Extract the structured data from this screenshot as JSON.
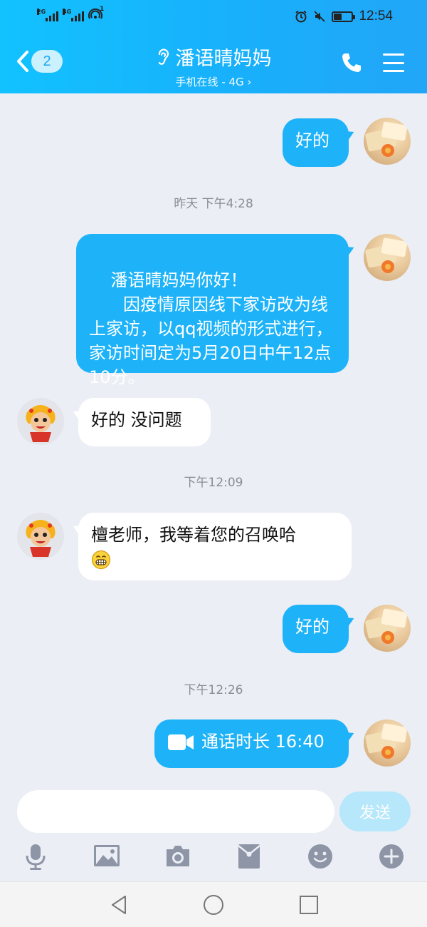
{
  "status_bar": {
    "signal1_tag": "2G",
    "signal2_tag": "4G",
    "hotspot_count": "1",
    "time": "12:54",
    "battery_level": 0.4
  },
  "title_bar": {
    "unread_count": "2",
    "contact_name": "潘语晴妈妈",
    "status": "手机在线 - 4G ›"
  },
  "messages": [
    {
      "type": "out",
      "text": "好的"
    },
    {
      "type": "time",
      "text": "昨天 下午4:28"
    },
    {
      "type": "out",
      "text": "潘语晴妈妈你好！\n　　因疫情原因线下家访改为线上家访，以qq视频的形式进行，家访时间定为5月20日中午12点10分。"
    },
    {
      "type": "in",
      "text": "好的 没问题"
    },
    {
      "type": "time",
      "text": "下午12:09"
    },
    {
      "type": "in",
      "text": "檀老师，我等着您的召唤哈"
    },
    {
      "type": "out",
      "text": "好的"
    },
    {
      "type": "time",
      "text": "下午12:26"
    },
    {
      "type": "call",
      "text": "通话时长 16:40"
    }
  ],
  "input": {
    "placeholder": "",
    "send_label": "发送"
  },
  "toolbar": {
    "items": [
      "microphone-icon",
      "image-icon",
      "camera-icon",
      "red-packet-icon",
      "emoji-icon",
      "plus-icon"
    ]
  },
  "nav": {
    "items": [
      "back-triangle-icon",
      "home-circle-icon",
      "recents-square-icon"
    ]
  },
  "colors": {
    "header_start": "#12c2ff",
    "header_end": "#22a6f7",
    "bubble_out": "#1eb3f8",
    "bubble_in": "#ffffff",
    "chat_bg": "#ebeef5",
    "send_btn": "#b6e7fb"
  }
}
